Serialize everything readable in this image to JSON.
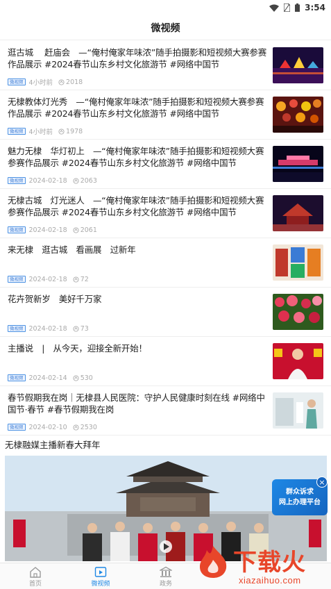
{
  "status": {
    "time": "3:54"
  },
  "header": {
    "title": "微视频"
  },
  "items": [
    {
      "text": "逛古城　 赶庙会　—“俺村俺家年味浓”随手拍摄影和短视频大赛参赛作品展示 #2024春节山东乡村文化旅游节 #网络中国节",
      "badge": "微视频",
      "time": "4小时前",
      "views": "2018"
    },
    {
      "text": "无棣教体灯光秀　—“俺村俺家年味浓”随手拍摄影和短视频大赛参赛作品展示 #2024春节山东乡村文化旅游节 #网络中国节",
      "badge": "微视频",
      "time": "4小时前",
      "views": "1978"
    },
    {
      "text": "魅力无棣　华灯初上　—“俺村俺家年味浓”随手拍摄影和短视频大赛参赛作品展示 #2024春节山东乡村文化旅游节 #网络中国节",
      "badge": "微视频",
      "time": "2024-02-18",
      "views": "2063"
    },
    {
      "text": "无棣古城　灯光迷人　—“俺村俺家年味浓”随手拍摄影和短视频大赛参赛作品展示 #2024春节山东乡村文化旅游节 #网络中国节",
      "badge": "微视频",
      "time": "2024-02-18",
      "views": "2061"
    },
    {
      "text": "来无棣　逛古城　看画展　过新年",
      "badge": "微视频",
      "time": "2024-02-18",
      "views": "72"
    },
    {
      "text": "花卉贺新岁　美好千万家",
      "badge": "微视频",
      "time": "2024-02-18",
      "views": "73"
    },
    {
      "text": "主播说　|　从今天，迎接全新开始！",
      "badge": "微视频",
      "time": "2024-02-14",
      "views": "530"
    },
    {
      "text": "春节假期我在岗｜无棣县人民医院：守护人民健康时刻在线 #网络中国节·春节 #春节假期我在岗",
      "badge": "微视频",
      "time": "2024-02-10",
      "views": "2530"
    }
  ],
  "section": {
    "title": "无棣融媒主播新春大拜年"
  },
  "promo": {
    "line1": "群众诉求",
    "line2": "网上办理平台",
    "close": "×"
  },
  "watermark": {
    "text": "下载火",
    "url": "xiazaihuo.com"
  },
  "tabs": [
    {
      "label": "首页"
    },
    {
      "label": "微视频"
    },
    {
      "label": "政务"
    }
  ],
  "colors": {
    "accent": "#1e88e5",
    "watermark": "#e8462a"
  }
}
